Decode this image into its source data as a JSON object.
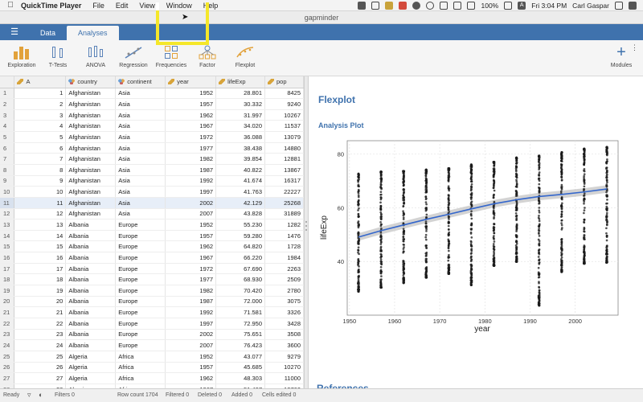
{
  "menubar": {
    "app_name": "QuickTime Player",
    "items": [
      "File",
      "Edit",
      "View",
      "Window",
      "Help"
    ],
    "battery": "100%",
    "clock": "Fri 3:04 PM",
    "user": "Carl Gaspar",
    "user_initial": "A"
  },
  "window": {
    "title": "gapminder"
  },
  "tabs": [
    {
      "label": "Data",
      "active": false
    },
    {
      "label": "Analyses",
      "active": true
    }
  ],
  "ribbon": {
    "buttons": [
      {
        "label": "Exploration",
        "icon": "exploration-icon"
      },
      {
        "label": "T-Tests",
        "icon": "t-tests-icon"
      },
      {
        "label": "ANOVA",
        "icon": "anova-icon"
      },
      {
        "label": "Regression",
        "icon": "regression-icon"
      },
      {
        "label": "Frequencies",
        "icon": "frequencies-icon"
      },
      {
        "label": "Factor",
        "icon": "factor-icon"
      },
      {
        "label": "Flexplot",
        "icon": "flexplot-icon"
      }
    ],
    "modules_label": "Modules"
  },
  "grid": {
    "columns": [
      "A",
      "country",
      "continent",
      "year",
      "lifeExp",
      "pop"
    ],
    "rows": [
      [
        "1",
        "1",
        "Afghanistan",
        "Asia",
        "1952",
        "28.801",
        "8425"
      ],
      [
        "2",
        "2",
        "Afghanistan",
        "Asia",
        "1957",
        "30.332",
        "9240"
      ],
      [
        "3",
        "3",
        "Afghanistan",
        "Asia",
        "1962",
        "31.997",
        "10267"
      ],
      [
        "4",
        "4",
        "Afghanistan",
        "Asia",
        "1967",
        "34.020",
        "11537"
      ],
      [
        "5",
        "5",
        "Afghanistan",
        "Asia",
        "1972",
        "36.088",
        "13079"
      ],
      [
        "6",
        "6",
        "Afghanistan",
        "Asia",
        "1977",
        "38.438",
        "14880"
      ],
      [
        "7",
        "7",
        "Afghanistan",
        "Asia",
        "1982",
        "39.854",
        "12881"
      ],
      [
        "8",
        "8",
        "Afghanistan",
        "Asia",
        "1987",
        "40.822",
        "13867"
      ],
      [
        "9",
        "9",
        "Afghanistan",
        "Asia",
        "1992",
        "41.674",
        "16317"
      ],
      [
        "10",
        "10",
        "Afghanistan",
        "Asia",
        "1997",
        "41.763",
        "22227"
      ],
      [
        "11",
        "11",
        "Afghanistan",
        "Asia",
        "2002",
        "42.129",
        "25268"
      ],
      [
        "12",
        "12",
        "Afghanistan",
        "Asia",
        "2007",
        "43.828",
        "31889"
      ],
      [
        "13",
        "13",
        "Albania",
        "Europe",
        "1952",
        "55.230",
        "1282"
      ],
      [
        "14",
        "14",
        "Albania",
        "Europe",
        "1957",
        "59.280",
        "1476"
      ],
      [
        "15",
        "15",
        "Albania",
        "Europe",
        "1962",
        "64.820",
        "1728"
      ],
      [
        "16",
        "16",
        "Albania",
        "Europe",
        "1967",
        "66.220",
        "1984"
      ],
      [
        "17",
        "17",
        "Albania",
        "Europe",
        "1972",
        "67.690",
        "2263"
      ],
      [
        "18",
        "18",
        "Albania",
        "Europe",
        "1977",
        "68.930",
        "2509"
      ],
      [
        "19",
        "19",
        "Albania",
        "Europe",
        "1982",
        "70.420",
        "2780"
      ],
      [
        "20",
        "20",
        "Albania",
        "Europe",
        "1987",
        "72.000",
        "3075"
      ],
      [
        "21",
        "21",
        "Albania",
        "Europe",
        "1992",
        "71.581",
        "3326"
      ],
      [
        "22",
        "22",
        "Albania",
        "Europe",
        "1997",
        "72.950",
        "3428"
      ],
      [
        "23",
        "23",
        "Albania",
        "Europe",
        "2002",
        "75.651",
        "3508"
      ],
      [
        "24",
        "24",
        "Albania",
        "Europe",
        "2007",
        "76.423",
        "3600"
      ],
      [
        "25",
        "25",
        "Algeria",
        "Africa",
        "1952",
        "43.077",
        "9279"
      ],
      [
        "26",
        "26",
        "Algeria",
        "Africa",
        "1957",
        "45.685",
        "10270"
      ],
      [
        "27",
        "27",
        "Algeria",
        "Africa",
        "1962",
        "48.303",
        "11000"
      ],
      [
        "28",
        "28",
        "Algeria",
        "Africa",
        "1967",
        "51.407",
        "12760"
      ]
    ],
    "selected_row": 11
  },
  "results": {
    "heading": "Flexplot",
    "subheading": "Analysis Plot",
    "references_heading": "References"
  },
  "chart_data": {
    "type": "scatter",
    "xlabel": "year",
    "ylabel": "lifeExp",
    "xlim": [
      1949.5,
      2009.5
    ],
    "ylim": [
      20,
      85
    ],
    "xticks": [
      1950,
      1960,
      1970,
      1980,
      1990,
      2000
    ],
    "yticks": [
      40,
      60,
      80
    ],
    "grid": true,
    "x": [
      1952,
      1957,
      1962,
      1967,
      1972,
      1977,
      1982,
      1987,
      1992,
      1997,
      2002,
      2007
    ],
    "point_ranges": [
      {
        "year": 1952,
        "min": 28.8,
        "max": 72.7
      },
      {
        "year": 1957,
        "min": 30.3,
        "max": 73.5
      },
      {
        "year": 1962,
        "min": 32.0,
        "max": 73.7
      },
      {
        "year": 1967,
        "min": 34.0,
        "max": 74.2
      },
      {
        "year": 1972,
        "min": 35.4,
        "max": 74.7
      },
      {
        "year": 1977,
        "min": 31.2,
        "max": 76.1
      },
      {
        "year": 1982,
        "min": 38.4,
        "max": 77.1
      },
      {
        "year": 1987,
        "min": 39.9,
        "max": 78.7
      },
      {
        "year": 1992,
        "min": 23.6,
        "max": 79.4
      },
      {
        "year": 1997,
        "min": 36.1,
        "max": 80.7
      },
      {
        "year": 2002,
        "min": 39.2,
        "max": 82.0
      },
      {
        "year": 2007,
        "min": 39.6,
        "max": 82.6
      }
    ],
    "fit_line": {
      "x": [
        1952,
        1957,
        1962,
        1967,
        1972,
        1977,
        1982,
        1987,
        1992,
        1997,
        2002,
        2007
      ],
      "y": [
        49.1,
        51.5,
        53.6,
        55.7,
        57.6,
        59.6,
        61.5,
        63.0,
        64.2,
        65.0,
        65.9,
        67.0
      ]
    },
    "colors": {
      "points": "#1a1a1a",
      "fit": "#3366cc",
      "band": "#bcbcbc",
      "accent": "#3f72ad"
    }
  },
  "statusbar": {
    "ready": "Ready",
    "filters": "Filters 0",
    "row_count": "Row count 1704",
    "filtered": "Filtered 0",
    "deleted": "Deleted 0",
    "added": "Added 0",
    "cells_edited": "Cells edited 0"
  }
}
